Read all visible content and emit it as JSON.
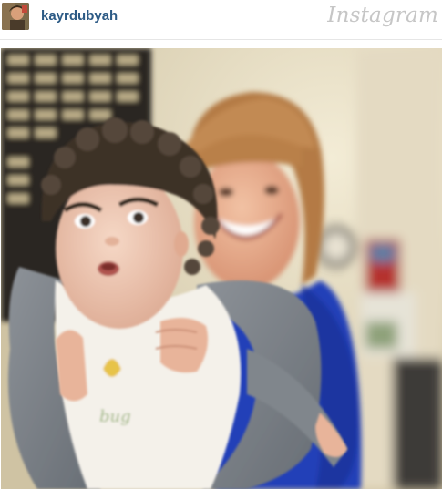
{
  "post": {
    "username": "kayrdubyah",
    "brand": "Instagram",
    "avatar_icon": "profile-avatar",
    "photo_alt": "Photo by kayrdubyah"
  },
  "colors": {
    "username": "#2c5a85",
    "brand": "#c6c6c6",
    "divider": "#e6e6e6"
  }
}
